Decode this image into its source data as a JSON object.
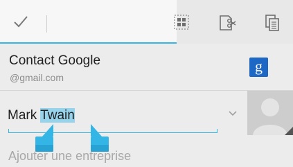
{
  "action_bar": {
    "done_icon": "check-icon",
    "actions": [
      {
        "name": "select-all",
        "icon": "select-all-icon"
      },
      {
        "name": "cut",
        "icon": "scissors-icon"
      },
      {
        "name": "copy",
        "icon": "copy-icon"
      }
    ],
    "accent_color": "#33b5e5"
  },
  "account": {
    "title": "Contact Google",
    "subtitle": "@gmail.com",
    "badge_letter": "g",
    "badge_color": "#1d67c5"
  },
  "name_field": {
    "value_before_selection": "Mark ",
    "selected_text": "Twain",
    "selection_color": "#98d3ec"
  },
  "company_field": {
    "placeholder": "Ajouter une entreprise"
  },
  "photo": {
    "icon": "default-contact-photo-icon"
  }
}
